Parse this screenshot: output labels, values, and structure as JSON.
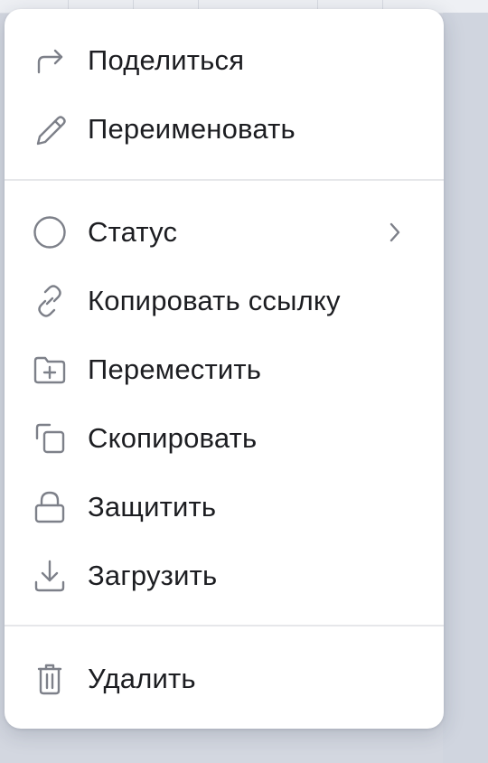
{
  "menu": {
    "items_group_1": [
      {
        "label": "Поделиться",
        "icon": "share-arrow-icon"
      },
      {
        "label": "Переименовать",
        "icon": "pencil-icon"
      }
    ],
    "items_group_2": [
      {
        "label": "Статус",
        "icon": "circle-status-icon",
        "has_submenu": true
      },
      {
        "label": "Копировать ссылку",
        "icon": "link-icon"
      },
      {
        "label": "Переместить",
        "icon": "folder-plus-icon"
      },
      {
        "label": "Скопировать",
        "icon": "copy-icon"
      },
      {
        "label": "Защитить",
        "icon": "lock-icon"
      },
      {
        "label": "Загрузить",
        "icon": "download-icon"
      }
    ],
    "items_group_3": [
      {
        "label": "Удалить",
        "icon": "trash-icon"
      }
    ]
  },
  "colors": {
    "menu_background": "#ffffff",
    "icon_stroke": "#7d8089",
    "text": "#1c1d21",
    "divider": "#e6e7ea",
    "backdrop": "#d3d7e0"
  }
}
